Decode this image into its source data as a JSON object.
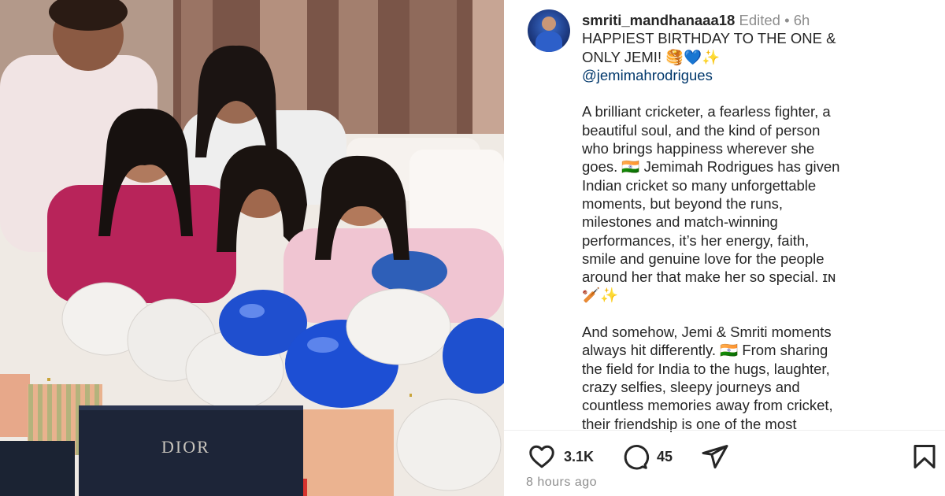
{
  "post": {
    "username": "smriti_mandhanaaa18",
    "edited_label": "Edited",
    "separator": "•",
    "age": "6h",
    "caption_lines_1": [
      "HAPPIEST BIRTHDAY TO THE ONE &",
      "ONLY JEMI! 🥞💙✨"
    ],
    "mention": "@jemimahrodrigues",
    "paragraph_1": [
      "A brilliant cricketer, a fearless fighter, a",
      "beautiful soul, and the kind of person",
      "who brings happiness wherever she",
      "goes. 🇮🇳 Jemimah Rodrigues has given",
      "Indian cricket so many unforgettable",
      "moments, but beyond the runs,",
      "milestones and match-winning",
      "performances, it’s her energy, faith,",
      "smile and genuine love for the people",
      "around her that make her so special. ɪɴ",
      "🏏✨"
    ],
    "paragraph_2": [
      "And somehow, Jemi & Smriti moments",
      "always hit differently. 🇮🇳 From sharing",
      "the field for India to the hugs, laughter,",
      "crazy selfies, sleepy journeys and",
      "countless memories away from cricket,",
      "their friendship is one of the most"
    ],
    "likes": "3.1K",
    "comments": "45",
    "timestamp": "8 hours ago"
  },
  "photo": {
    "box_brand": "DIOR"
  },
  "icons": {
    "like": "heart-icon",
    "comment": "comment-icon",
    "share": "share-icon",
    "save": "bookmark-icon"
  },
  "colors": {
    "mention": "#00376b",
    "meta": "#8e8e8e",
    "text": "#262626",
    "balloon_blue": "#1f4fcf"
  }
}
